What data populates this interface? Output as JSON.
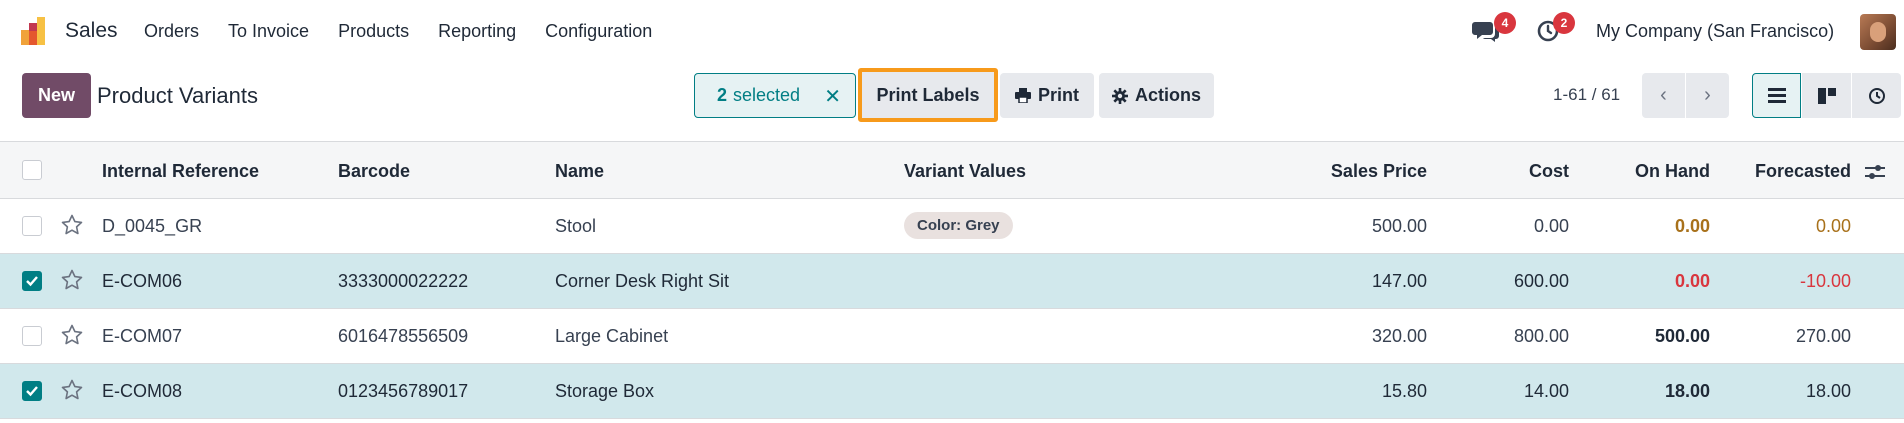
{
  "navbar": {
    "app_name": "Sales",
    "menu": [
      "Orders",
      "To Invoice",
      "Products",
      "Reporting",
      "Configuration"
    ],
    "chat_badge": "4",
    "activity_badge": "2",
    "company": "My Company (San Francisco)"
  },
  "control": {
    "new_label": "New",
    "title": "Product Variants",
    "selected_count": "2",
    "selected_label": "selected",
    "print_labels": "Print Labels",
    "print": "Print",
    "actions": "Actions",
    "pager": "1-61 / 61"
  },
  "table": {
    "headers": {
      "internal_reference": "Internal Reference",
      "barcode": "Barcode",
      "name": "Name",
      "variant_values": "Variant Values",
      "sales_price": "Sales Price",
      "cost": "Cost",
      "on_hand": "On Hand",
      "forecasted": "Forecasted"
    },
    "rows": [
      {
        "ref": "D_0045_GR",
        "barcode": "",
        "name": "Stool",
        "variant": "Color: Grey",
        "price": "500.00",
        "cost": "0.00",
        "on_hand": "0.00",
        "forecasted": "0.00",
        "checked": false
      },
      {
        "ref": "E-COM06",
        "barcode": "3333000022222",
        "name": "Corner Desk Right Sit",
        "variant": "",
        "price": "147.00",
        "cost": "600.00",
        "on_hand": "0.00",
        "forecasted": "-10.00",
        "checked": true
      },
      {
        "ref": "E-COM07",
        "barcode": "6016478556509",
        "name": "Large Cabinet",
        "variant": "",
        "price": "320.00",
        "cost": "800.00",
        "on_hand": "500.00",
        "forecasted": "270.00",
        "checked": false
      },
      {
        "ref": "E-COM08",
        "barcode": "0123456789017",
        "name": "Storage Box",
        "variant": "",
        "price": "15.80",
        "cost": "14.00",
        "on_hand": "18.00",
        "forecasted": "18.00",
        "checked": true
      }
    ]
  },
  "colors": {
    "brand": "#714b67",
    "accent": "#017e84",
    "highlight": "#f79a1b",
    "selected_row": "#d1e8ec",
    "danger": "#d9363e",
    "warning": "#a8711b"
  }
}
